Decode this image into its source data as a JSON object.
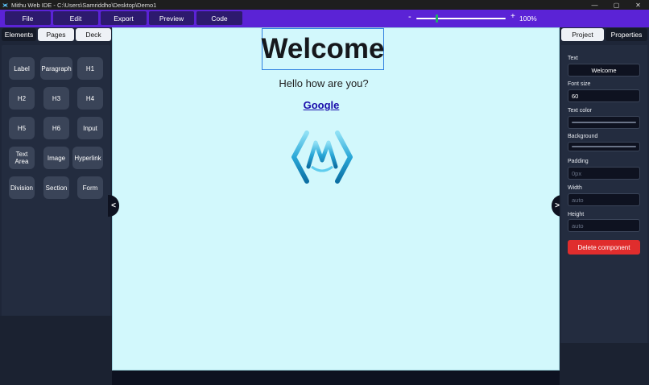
{
  "window": {
    "title": "Mithu Web IDE - C:\\Users\\Samriddho\\Desktop\\Demo1",
    "controls": {
      "minimize": "—",
      "maximize": "▢",
      "close": "✕"
    }
  },
  "menubar": {
    "items": [
      {
        "label": "File"
      },
      {
        "label": "Edit"
      },
      {
        "label": "Export"
      },
      {
        "label": "Preview"
      },
      {
        "label": "Code"
      }
    ],
    "zoom": {
      "minus": "-",
      "plus": "+",
      "value_label": "100%",
      "value_fraction": 0.22
    }
  },
  "left_panel": {
    "tabs": [
      {
        "label": "Elements",
        "active": true
      },
      {
        "label": "Pages",
        "active": false
      },
      {
        "label": "Deck",
        "active": false
      }
    ],
    "elements": [
      {
        "label": "Label"
      },
      {
        "label": "Paragraph"
      },
      {
        "label": "H1"
      },
      {
        "label": "H2"
      },
      {
        "label": "H3"
      },
      {
        "label": "H4"
      },
      {
        "label": "H5"
      },
      {
        "label": "H6"
      },
      {
        "label": "Input"
      },
      {
        "label": "Text Area"
      },
      {
        "label": "Image"
      },
      {
        "label": "Hyperlink"
      },
      {
        "label": "Division"
      },
      {
        "label": "Section"
      },
      {
        "label": "Form"
      }
    ],
    "collapse_label": "<"
  },
  "canvas": {
    "heading": "Welcome",
    "paragraph": "Hello how are you?",
    "link": "Google",
    "logo_icon": "mithu-m-logo-icon"
  },
  "right_panel": {
    "tabs": [
      {
        "label": "Project",
        "active": false
      },
      {
        "label": "Properties",
        "active": true
      }
    ],
    "collapse_label": ">",
    "properties": {
      "text_label": "Text",
      "text_value": "Welcome",
      "font_size_label": "Font size",
      "font_size_value": "60",
      "text_color_label": "Text color",
      "background_label": "Background",
      "padding_label": "Padding",
      "padding_placeholder": "0px",
      "width_label": "Width",
      "width_placeholder": "auto",
      "height_label": "Height",
      "height_placeholder": "auto"
    },
    "delete_label": "Delete component"
  },
  "colors": {
    "menubar": "#5b23d6",
    "canvas_bg": "#d2f8fc",
    "panel_bg": "#1e2638",
    "delete": "#e02d2d",
    "zoom_thumb": "#1fae6a"
  }
}
